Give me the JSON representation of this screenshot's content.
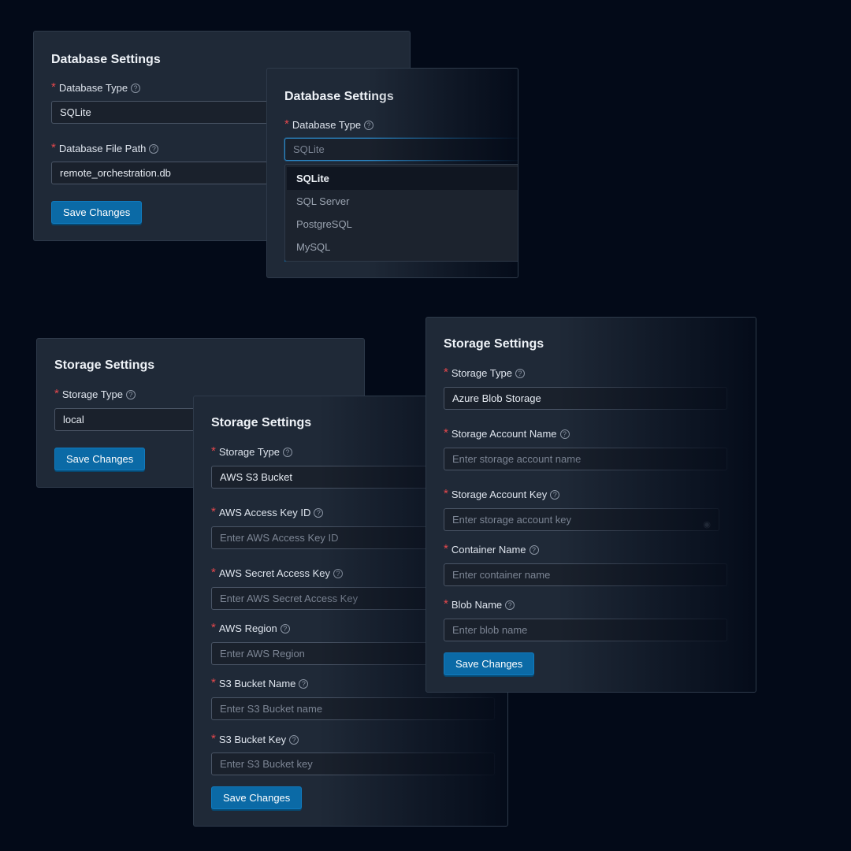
{
  "database_panel_a": {
    "title": "Database Settings",
    "type_label": "Database Type",
    "type_value": "SQLite",
    "path_label": "Database File Path",
    "path_value": "remote_orchestration.db",
    "save_label": "Save Changes"
  },
  "database_panel_b": {
    "title": "Database Settings",
    "type_label": "Database Type",
    "type_placeholder": "SQLite",
    "options": [
      "SQLite",
      "SQL Server",
      "PostgreSQL",
      "MySQL"
    ],
    "selected_option": "SQLite"
  },
  "storage_local": {
    "title": "Storage Settings",
    "type_label": "Storage Type",
    "type_value": "local",
    "save_label": "Save Changes"
  },
  "storage_s3": {
    "title": "Storage Settings",
    "type_label": "Storage Type",
    "type_value": "AWS S3 Bucket",
    "access_key_label": "AWS Access Key ID",
    "access_key_placeholder": "Enter AWS Access Key ID",
    "secret_key_label": "AWS Secret Access Key",
    "secret_key_placeholder": "Enter AWS Secret Access Key",
    "region_label": "AWS Region",
    "region_placeholder": "Enter AWS Region",
    "bucket_name_label": "S3 Bucket Name",
    "bucket_name_placeholder": "Enter S3 Bucket name",
    "bucket_key_label": "S3 Bucket Key",
    "bucket_key_placeholder": "Enter S3 Bucket key",
    "save_label": "Save Changes"
  },
  "storage_azure": {
    "title": "Storage Settings",
    "type_label": "Storage Type",
    "type_value": "Azure Blob Storage",
    "account_name_label": "Storage Account Name",
    "account_name_placeholder": "Enter storage account name",
    "account_key_label": "Storage Account Key",
    "account_key_placeholder": "Enter storage account key",
    "container_label": "Container Name",
    "container_placeholder": "Enter container name",
    "blob_label": "Blob Name",
    "blob_placeholder": "Enter blob name",
    "save_label": "Save Changes"
  },
  "icons": {
    "help": "question-circle-icon",
    "required": "asterisk",
    "reveal": "eye-off-icon"
  },
  "colors": {
    "accent": "#0b6aa6",
    "required": "#e5484d",
    "panel_bg": "#1f2937",
    "page_bg": "#030a18"
  }
}
